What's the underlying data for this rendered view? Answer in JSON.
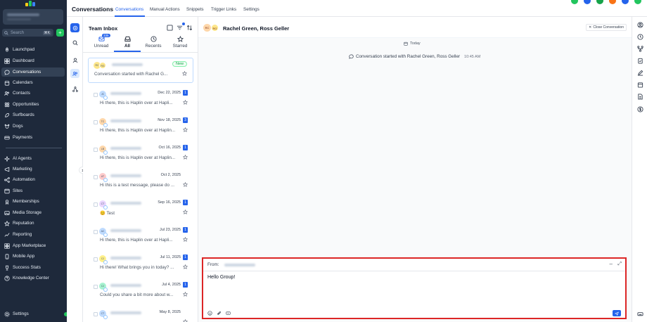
{
  "sidebar": {
    "search_placeholder": "Search",
    "search_shortcut": "⌘K",
    "add": "+",
    "items": [
      {
        "label": "Launchpad",
        "icon": "rocket-icon"
      },
      {
        "label": "Dashboard",
        "icon": "dashboard-icon"
      },
      {
        "label": "Conversations",
        "icon": "chat-icon",
        "active": true
      },
      {
        "label": "Calendars",
        "icon": "calendar-icon"
      },
      {
        "label": "Contacts",
        "icon": "contacts-icon"
      },
      {
        "label": "Opportunities",
        "icon": "opportunities-icon"
      },
      {
        "label": "Surfboards",
        "icon": "surfboard-icon"
      },
      {
        "label": "Dogs",
        "icon": "dog-icon"
      },
      {
        "label": "Payments",
        "icon": "payments-icon"
      },
      {
        "label": "AI Agents",
        "icon": "ai-agents-icon"
      },
      {
        "label": "Marketing",
        "icon": "marketing-icon"
      },
      {
        "label": "Automation",
        "icon": "automation-icon"
      },
      {
        "label": "Sites",
        "icon": "sites-icon"
      },
      {
        "label": "Memberships",
        "icon": "memberships-icon"
      },
      {
        "label": "Media Storage",
        "icon": "media-storage-icon"
      },
      {
        "label": "Reputation",
        "icon": "star-icon"
      },
      {
        "label": "Reporting",
        "icon": "reporting-icon"
      },
      {
        "label": "App Marketplace",
        "icon": "app-marketplace-icon"
      },
      {
        "label": "Mobile App",
        "icon": "mobile-icon"
      },
      {
        "label": "Success Stats",
        "icon": "trophy-icon"
      },
      {
        "label": "Knowledge Center",
        "icon": "knowledge-icon"
      }
    ],
    "settings_label": "Settings"
  },
  "topbar": {
    "title": "Conversations",
    "tabs": [
      "Conversations",
      "Manual Actions",
      "Snippets",
      "Trigger Links",
      "Settings"
    ],
    "active_tab": "Conversations"
  },
  "list": {
    "title": "Team Inbox",
    "filters": [
      {
        "label": "Unread",
        "count": "335"
      },
      {
        "label": "All",
        "active": true
      },
      {
        "label": "Recents"
      },
      {
        "label": "Starred"
      }
    ],
    "conversations": [
      {
        "initials": "RC",
        "initials2": "RG",
        "date": "",
        "badge": "",
        "status": "New",
        "snippet": "Conversation started with Rachel G...",
        "selected": true
      },
      {
        "initials": "JC",
        "date": "Dec 22, 2025",
        "badge": "1",
        "snippet": "Hi there, this is Haplin over at Hapli..."
      },
      {
        "initials": "TC",
        "date": "Nov 18, 2025",
        "badge": "3",
        "snippet": "Hi there, this is Haplin over at Haplin..."
      },
      {
        "initials": "LB",
        "date": "Oct 16, 2025",
        "badge": "1",
        "snippet": "Hi there, this is Haplin over at Haplin..."
      },
      {
        "initials": "AT",
        "date": "Oct 2, 2025",
        "badge": "",
        "snippet": "Hi this is a test message, please do ..."
      },
      {
        "initials": "CT",
        "date": "Sep 16, 2025",
        "badge": "1",
        "snippet": "Test",
        "emoji": "😊"
      },
      {
        "initials": "AC",
        "date": "Jul 23, 2025",
        "badge": "1",
        "snippet": "Hi there, this is Haplin over at Hapli..."
      },
      {
        "initials": "CJ",
        "date": "Jul 11, 2025",
        "badge": "1",
        "snippet": "Hi there! What brings you in today? ..."
      },
      {
        "initials": "CJ",
        "date": "Jul 4, 2025",
        "badge": "1",
        "snippet": "Could you share a bit more about w..."
      },
      {
        "initials": "CT",
        "date": "May 8, 2025",
        "badge": "",
        "snippet": ""
      }
    ]
  },
  "main": {
    "participants": "Rachel Green, Ross Geller",
    "avatar1": "RC",
    "avatar2": "RG",
    "close_label": "Close Conversation",
    "today_label": "Today",
    "started_text": "Conversation started with Rachel Green, Ross Geller",
    "started_time": "10:45 AM"
  },
  "composer": {
    "from_label": "From:",
    "message": "Hello Group!"
  },
  "colors": {
    "sidebar_bg": "#1e293b",
    "accent": "#2563eb",
    "highlight_border": "#dc2626"
  }
}
